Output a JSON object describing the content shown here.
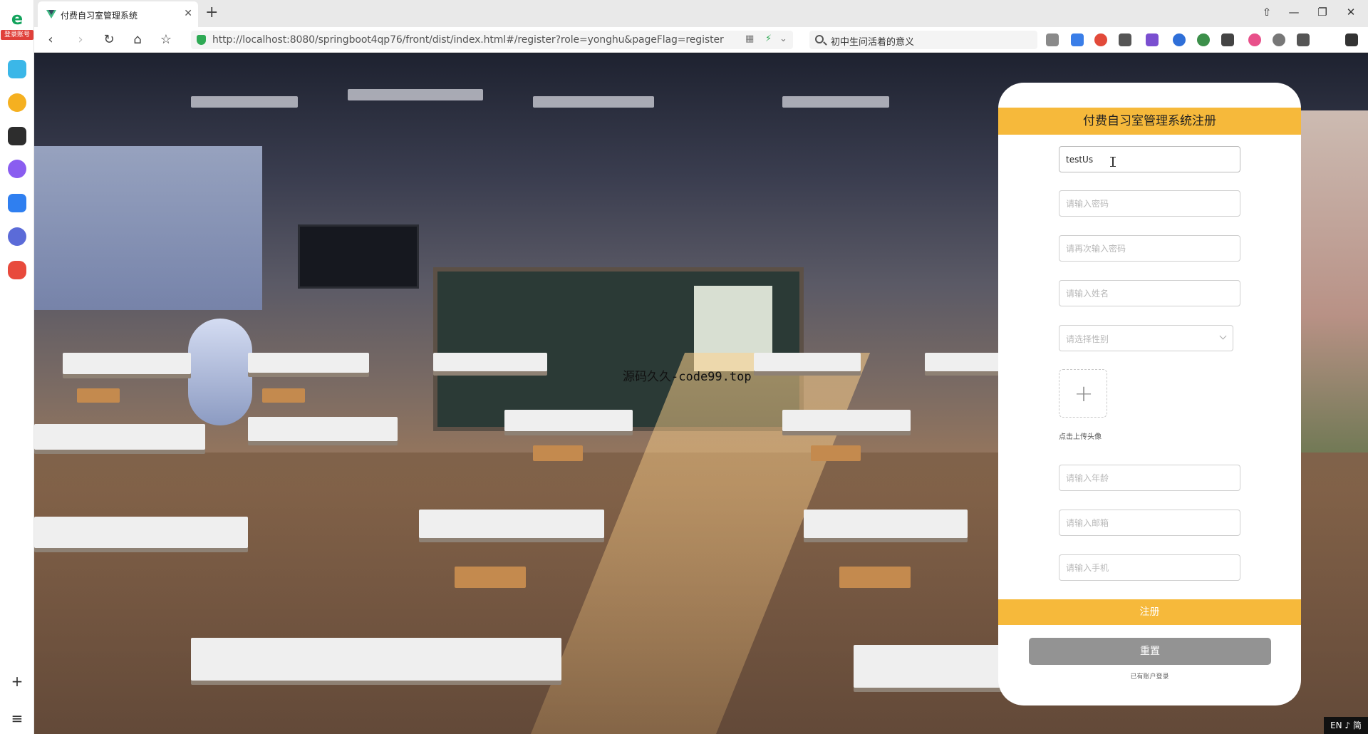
{
  "sidebar": {
    "logo_tag": "登录账号",
    "icons": [
      "green-plus-app-icon",
      "star-app-icon",
      "bilibili-tv-icon",
      "ai-assistant-icon",
      "ai-square-icon",
      "robot-icon",
      "game-controller-icon"
    ],
    "bottom": {
      "add": "+",
      "list": "≡"
    }
  },
  "browser": {
    "tab_title": "付费自习室管理系统",
    "url": "http://localhost:8080/springboot4qp76/front/dist/index.html#/register?role=yonghu&pageFlag=register",
    "search_text": "初中生问活着的意义"
  },
  "page": {
    "watermark": "源码久久-code99.top"
  },
  "register": {
    "title": "付费自习室管理系统注册",
    "username_value": "testUs",
    "password_placeholder": "请输入密码",
    "confirm_password_placeholder": "请再次输入密码",
    "name_placeholder": "请输入姓名",
    "gender_placeholder": "请选择性别",
    "avatar_tip": "点击上传头像",
    "age_placeholder": "请输入年龄",
    "email_placeholder": "请输入邮箱",
    "phone_placeholder": "请输入手机",
    "register_button": "注册",
    "reset_button": "重置",
    "login_link": "已有账户登录"
  },
  "taskbar": {
    "ime": "EN ♪ 简"
  },
  "colors": {
    "accent": "#f6b93b",
    "reset_button": "#939393",
    "secure_green": "#2faa55"
  }
}
